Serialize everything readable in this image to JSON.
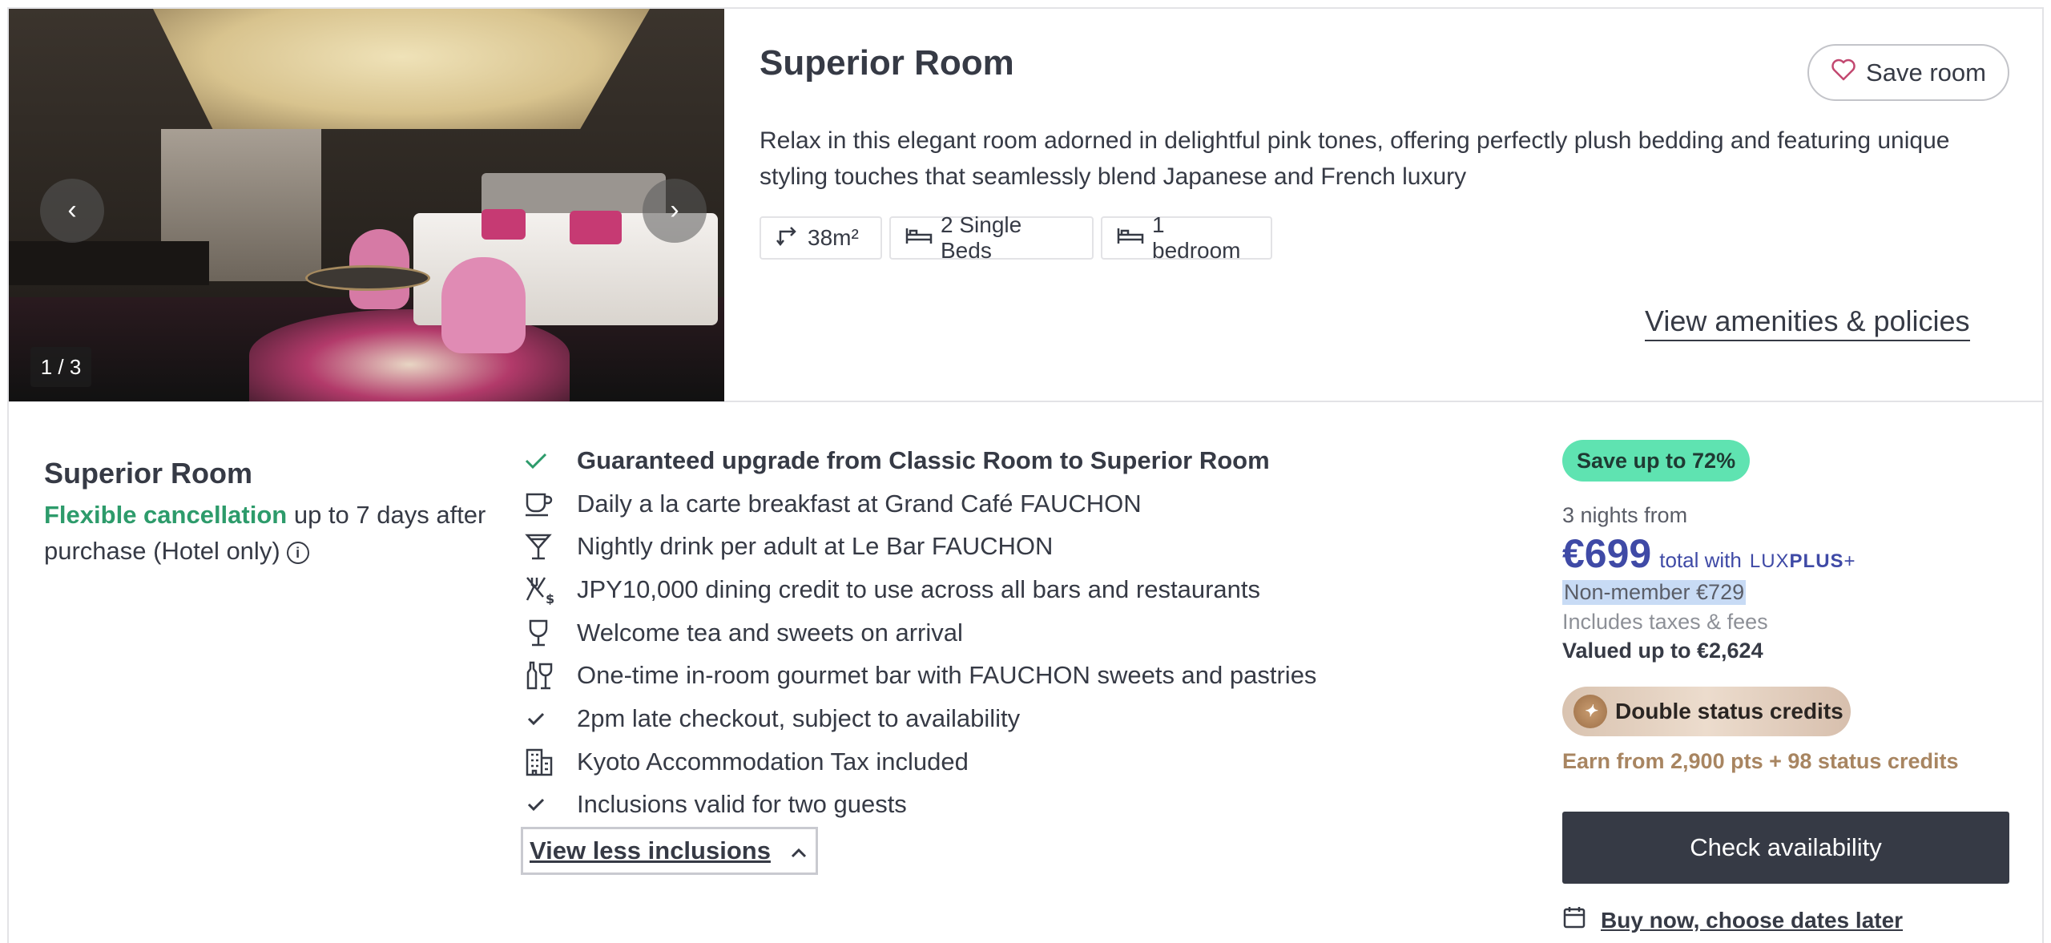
{
  "photo": {
    "counter": "1 / 3",
    "prev_icon": "chevron-left",
    "next_icon": "chevron-right"
  },
  "room": {
    "title": "Superior Room",
    "save_label": "Save room",
    "description": "Relax in this elegant room adorned in delightful pink tones, offering perfectly plush bedding and featuring unique styling touches that seamlessly blend Japanese and French luxury",
    "features": [
      {
        "icon": "size-arrow-icon",
        "label": "38m²"
      },
      {
        "icon": "bed-icon",
        "label": "2 Single Beds"
      },
      {
        "icon": "bed-icon",
        "label": "1 bedroom"
      }
    ],
    "amenities_link": "View amenities & policies"
  },
  "option": {
    "title": "Superior Room",
    "cancel_highlight": "Flexible cancellation",
    "cancel_rest": " up to 7 days after purchase (Hotel only)",
    "info_icon": "i"
  },
  "inclusions": {
    "items": [
      {
        "icon": "check-icon",
        "label": "Guaranteed upgrade from Classic Room to Superior Room"
      },
      {
        "icon": "coffee-cup-icon",
        "label": "Daily a la carte breakfast at Grand Café FAUCHON"
      },
      {
        "icon": "cocktail-icon",
        "label": "Nightly drink per adult at Le Bar FAUCHON"
      },
      {
        "icon": "dining-credit-icon",
        "label": "JPY10,000 dining credit to use across all bars and restaurants"
      },
      {
        "icon": "wine-glass-icon",
        "label": "Welcome tea and sweets on arrival"
      },
      {
        "icon": "bottle-glass-icon",
        "label": "One-time in-room gourmet bar with FAUCHON sweets and pastries"
      },
      {
        "icon": "check-icon",
        "label": "2pm late checkout, subject to availability"
      },
      {
        "icon": "building-icon",
        "label": "Kyoto Accommodation Tax included"
      },
      {
        "icon": "check-icon",
        "label": "Inclusions valid for two guests"
      }
    ],
    "toggle_label": "View less inclusions"
  },
  "pricing": {
    "save_badge": "Save up to 72%",
    "nights": "3 nights from",
    "price": "€699",
    "price_suffix": "total with",
    "lux_1": "LUX",
    "lux_2": "PLUS",
    "lux_3": "+",
    "non_member": "Non-member €729",
    "taxes": "Includes taxes & fees",
    "valued": "Valued up to €2,624",
    "credits_label": "Double status credits",
    "earn": "Earn from 2,900 pts  + 98 status credits",
    "check_button": "Check availability",
    "buy_now": "Buy now, choose dates later",
    "colors": {
      "accent": "#3f4aa6",
      "badge": "#5fe3b1",
      "gold": "#a88561",
      "dark": "#363a45",
      "green": "#2d9b6b"
    }
  }
}
